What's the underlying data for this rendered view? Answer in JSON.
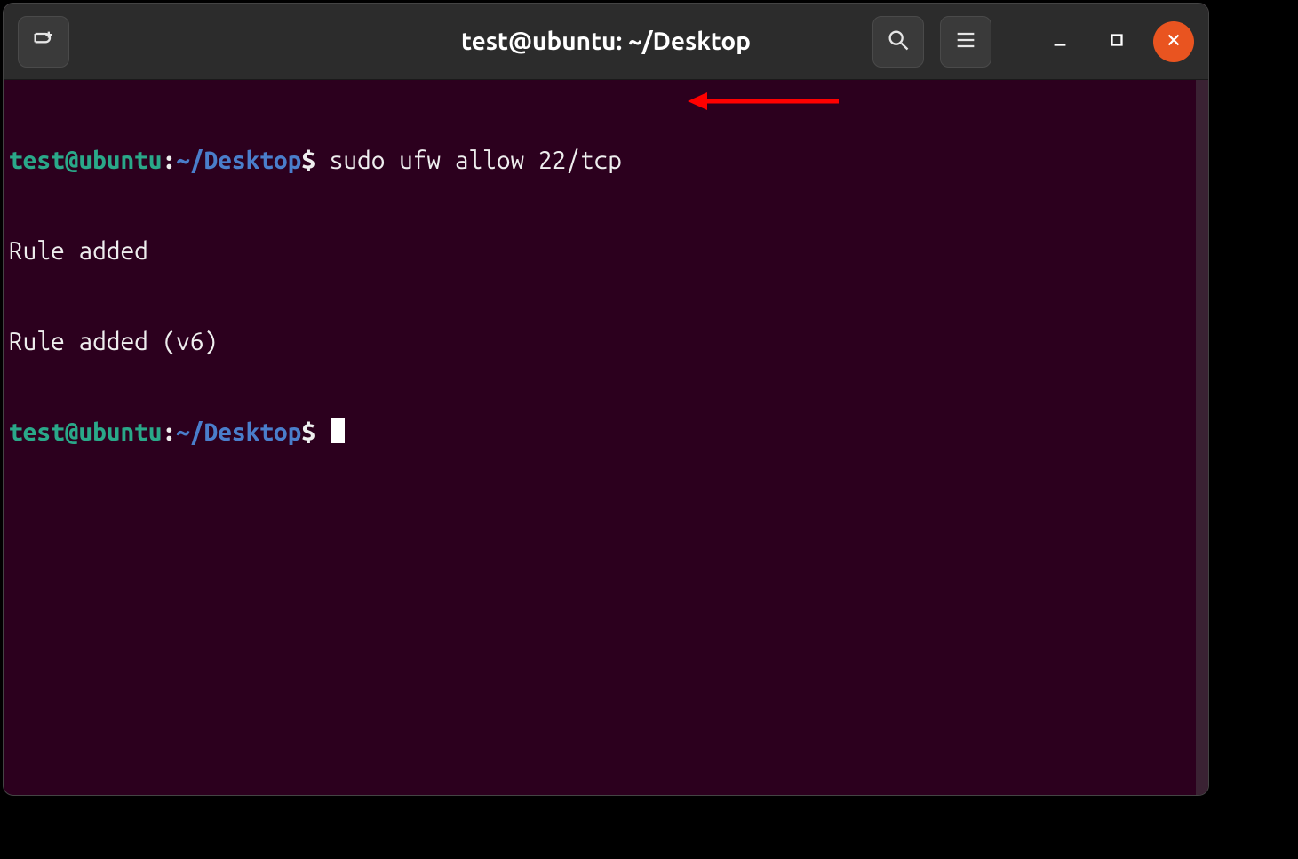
{
  "header": {
    "title": "test@ubuntu: ~/Desktop"
  },
  "terminal": {
    "prompt": {
      "user_host": "test@ubuntu",
      "separator": ":",
      "path": "~/Desktop",
      "symbol": "$"
    },
    "entries": [
      {
        "command": "sudo ufw allow 22/tcp",
        "output": [
          "Rule added",
          "Rule added (v6)"
        ]
      }
    ]
  },
  "annotation": {
    "arrow_color": "#ff0000"
  },
  "colors": {
    "background": "#2c001e",
    "titlebar": "#2c2c2c",
    "user_host": "#2aa889",
    "path": "#4a7ecb",
    "text": "#eeeeee",
    "close_button": "#e95420"
  }
}
